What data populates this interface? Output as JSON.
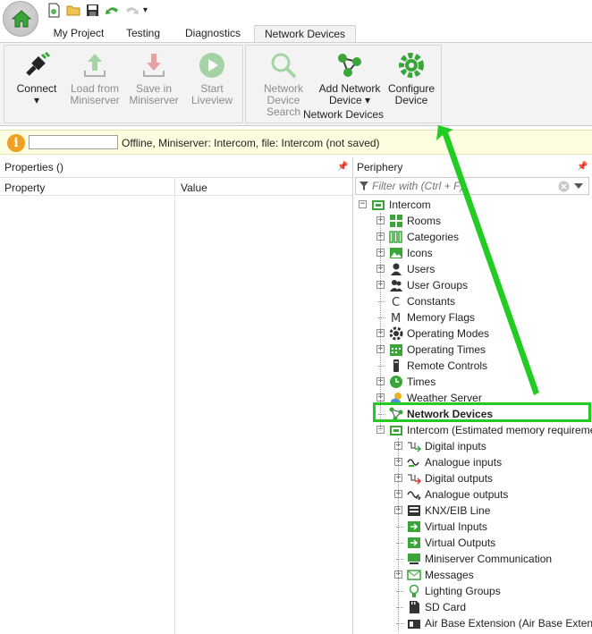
{
  "tabs": [
    "My Project",
    "Testing",
    "Diagnostics",
    "Network Devices"
  ],
  "ribbon": {
    "connect": {
      "line1": "Connect",
      "line2": "▾"
    },
    "load": {
      "line1": "Load from",
      "line2": "Miniserver"
    },
    "save": {
      "line1": "Save in",
      "line2": "Miniserver"
    },
    "liveview": {
      "line1": "Start",
      "line2": "Liveview"
    },
    "search": {
      "line1": "Network",
      "line2": "Device Search"
    },
    "add": {
      "line1": "Add Network",
      "line2": "Device ▾"
    },
    "configure": {
      "line1": "Configure",
      "line2": "Device"
    },
    "group_caption": "Network Devices"
  },
  "infobar": {
    "status": "Offline, Miniserver: Intercom, file: Intercom (not saved)",
    "field_value": ""
  },
  "properties": {
    "title": "Properties ()",
    "col_property": "Property",
    "col_value": "Value"
  },
  "periphery": {
    "title": "Periphery",
    "filter_placeholder": "Filter with (Ctrl + F)",
    "tree": [
      {
        "label": "Intercom",
        "icon": "miniserver-icon"
      },
      {
        "label": "Rooms",
        "icon": "rooms-icon"
      },
      {
        "label": "Categories",
        "icon": "categories-icon"
      },
      {
        "label": "Icons",
        "icon": "image-icon"
      },
      {
        "label": "Users",
        "icon": "user-icon"
      },
      {
        "label": "User Groups",
        "icon": "user-group-icon"
      },
      {
        "label": "Constants",
        "icon": "constant-icon"
      },
      {
        "label": "Memory Flags",
        "icon": "memory-flag-icon"
      },
      {
        "label": "Operating Modes",
        "icon": "gear-icon"
      },
      {
        "label": "Operating Times",
        "icon": "calendar-icon"
      },
      {
        "label": "Remote Controls",
        "icon": "remote-icon"
      },
      {
        "label": "Times",
        "icon": "clock-icon"
      },
      {
        "label": "Weather Server",
        "icon": "weather-icon"
      },
      {
        "label": "Network Devices",
        "icon": "network-devices-icon"
      },
      {
        "label": "Intercom (Estimated memory requirement)",
        "icon": "miniserver-icon"
      },
      {
        "label": "Digital inputs",
        "icon": "digital-input-icon"
      },
      {
        "label": "Analogue inputs",
        "icon": "analog-input-icon"
      },
      {
        "label": "Digital outputs",
        "icon": "digital-output-icon"
      },
      {
        "label": "Analogue outputs",
        "icon": "analog-output-icon"
      },
      {
        "label": "KNX/EIB Line",
        "icon": "knx-icon"
      },
      {
        "label": "Virtual Inputs",
        "icon": "virtual-input-icon"
      },
      {
        "label": "Virtual Outputs",
        "icon": "virtual-output-icon"
      },
      {
        "label": "Miniserver Communication",
        "icon": "communication-icon"
      },
      {
        "label": "Messages",
        "icon": "message-icon"
      },
      {
        "label": "Lighting Groups",
        "icon": "lighting-icon"
      },
      {
        "label": "SD Card",
        "icon": "sd-card-icon"
      },
      {
        "label": "Air Base Extension (Air Base Extension)",
        "icon": "air-base-icon"
      }
    ]
  },
  "colors": {
    "accent_green": "#22cc22",
    "info_bg": "#fdfde0",
    "ribbon_bg": "#f3f3f3"
  }
}
